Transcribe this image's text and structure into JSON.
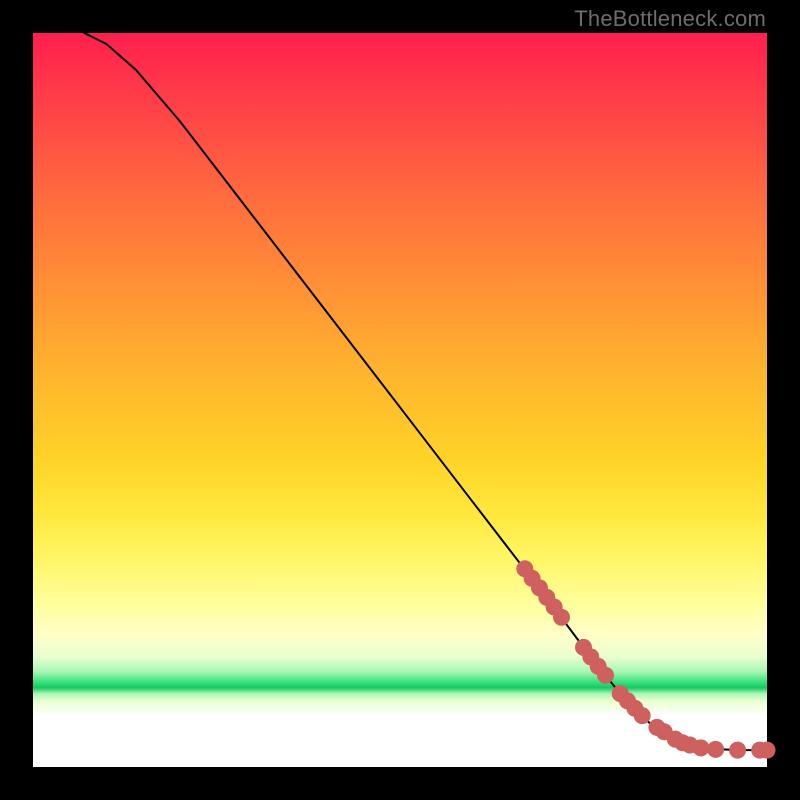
{
  "attribution": "TheBottleneck.com",
  "chart_data": {
    "type": "line",
    "title": "",
    "xlabel": "",
    "ylabel": "",
    "xlim": [
      0,
      100
    ],
    "ylim": [
      0,
      100
    ],
    "grid": false,
    "legend": false,
    "series": [
      {
        "name": "curve",
        "x": [
          7,
          10,
          14,
          20,
          30,
          40,
          50,
          60,
          70,
          76,
          80,
          84,
          88,
          92,
          96,
          100
        ],
        "y": [
          100,
          98.5,
          95,
          88,
          75,
          62,
          49,
          36,
          23,
          15,
          10,
          6,
          3.5,
          2.5,
          2.3,
          2.3
        ]
      }
    ],
    "markers": [
      {
        "x": 67,
        "y": 27.0
      },
      {
        "x": 68,
        "y": 25.7
      },
      {
        "x": 69,
        "y": 24.4
      },
      {
        "x": 70,
        "y": 23.1
      },
      {
        "x": 71,
        "y": 21.8
      },
      {
        "x": 72,
        "y": 20.4
      },
      {
        "x": 75,
        "y": 16.3
      },
      {
        "x": 76,
        "y": 15.0
      },
      {
        "x": 77,
        "y": 13.7
      },
      {
        "x": 78,
        "y": 12.5
      },
      {
        "x": 80,
        "y": 10.0
      },
      {
        "x": 81,
        "y": 9.0
      },
      {
        "x": 82,
        "y": 8.0
      },
      {
        "x": 83,
        "y": 7.0
      },
      {
        "x": 85,
        "y": 5.4
      },
      {
        "x": 86,
        "y": 4.8
      },
      {
        "x": 87.5,
        "y": 3.8
      },
      {
        "x": 88.5,
        "y": 3.3
      },
      {
        "x": 89.5,
        "y": 3.0
      },
      {
        "x": 91,
        "y": 2.6
      },
      {
        "x": 93,
        "y": 2.4
      },
      {
        "x": 96,
        "y": 2.3
      },
      {
        "x": 99,
        "y": 2.3
      },
      {
        "x": 100,
        "y": 2.3
      }
    ],
    "background_gradient": [
      {
        "stop": 0.0,
        "color": "#ff1f4e"
      },
      {
        "stop": 0.46,
        "color": "#ffd327"
      },
      {
        "stop": 0.78,
        "color": "#ffff9e"
      },
      {
        "stop": 0.885,
        "color": "#33e07a"
      },
      {
        "stop": 1.0,
        "color": "#ffffff"
      }
    ]
  }
}
